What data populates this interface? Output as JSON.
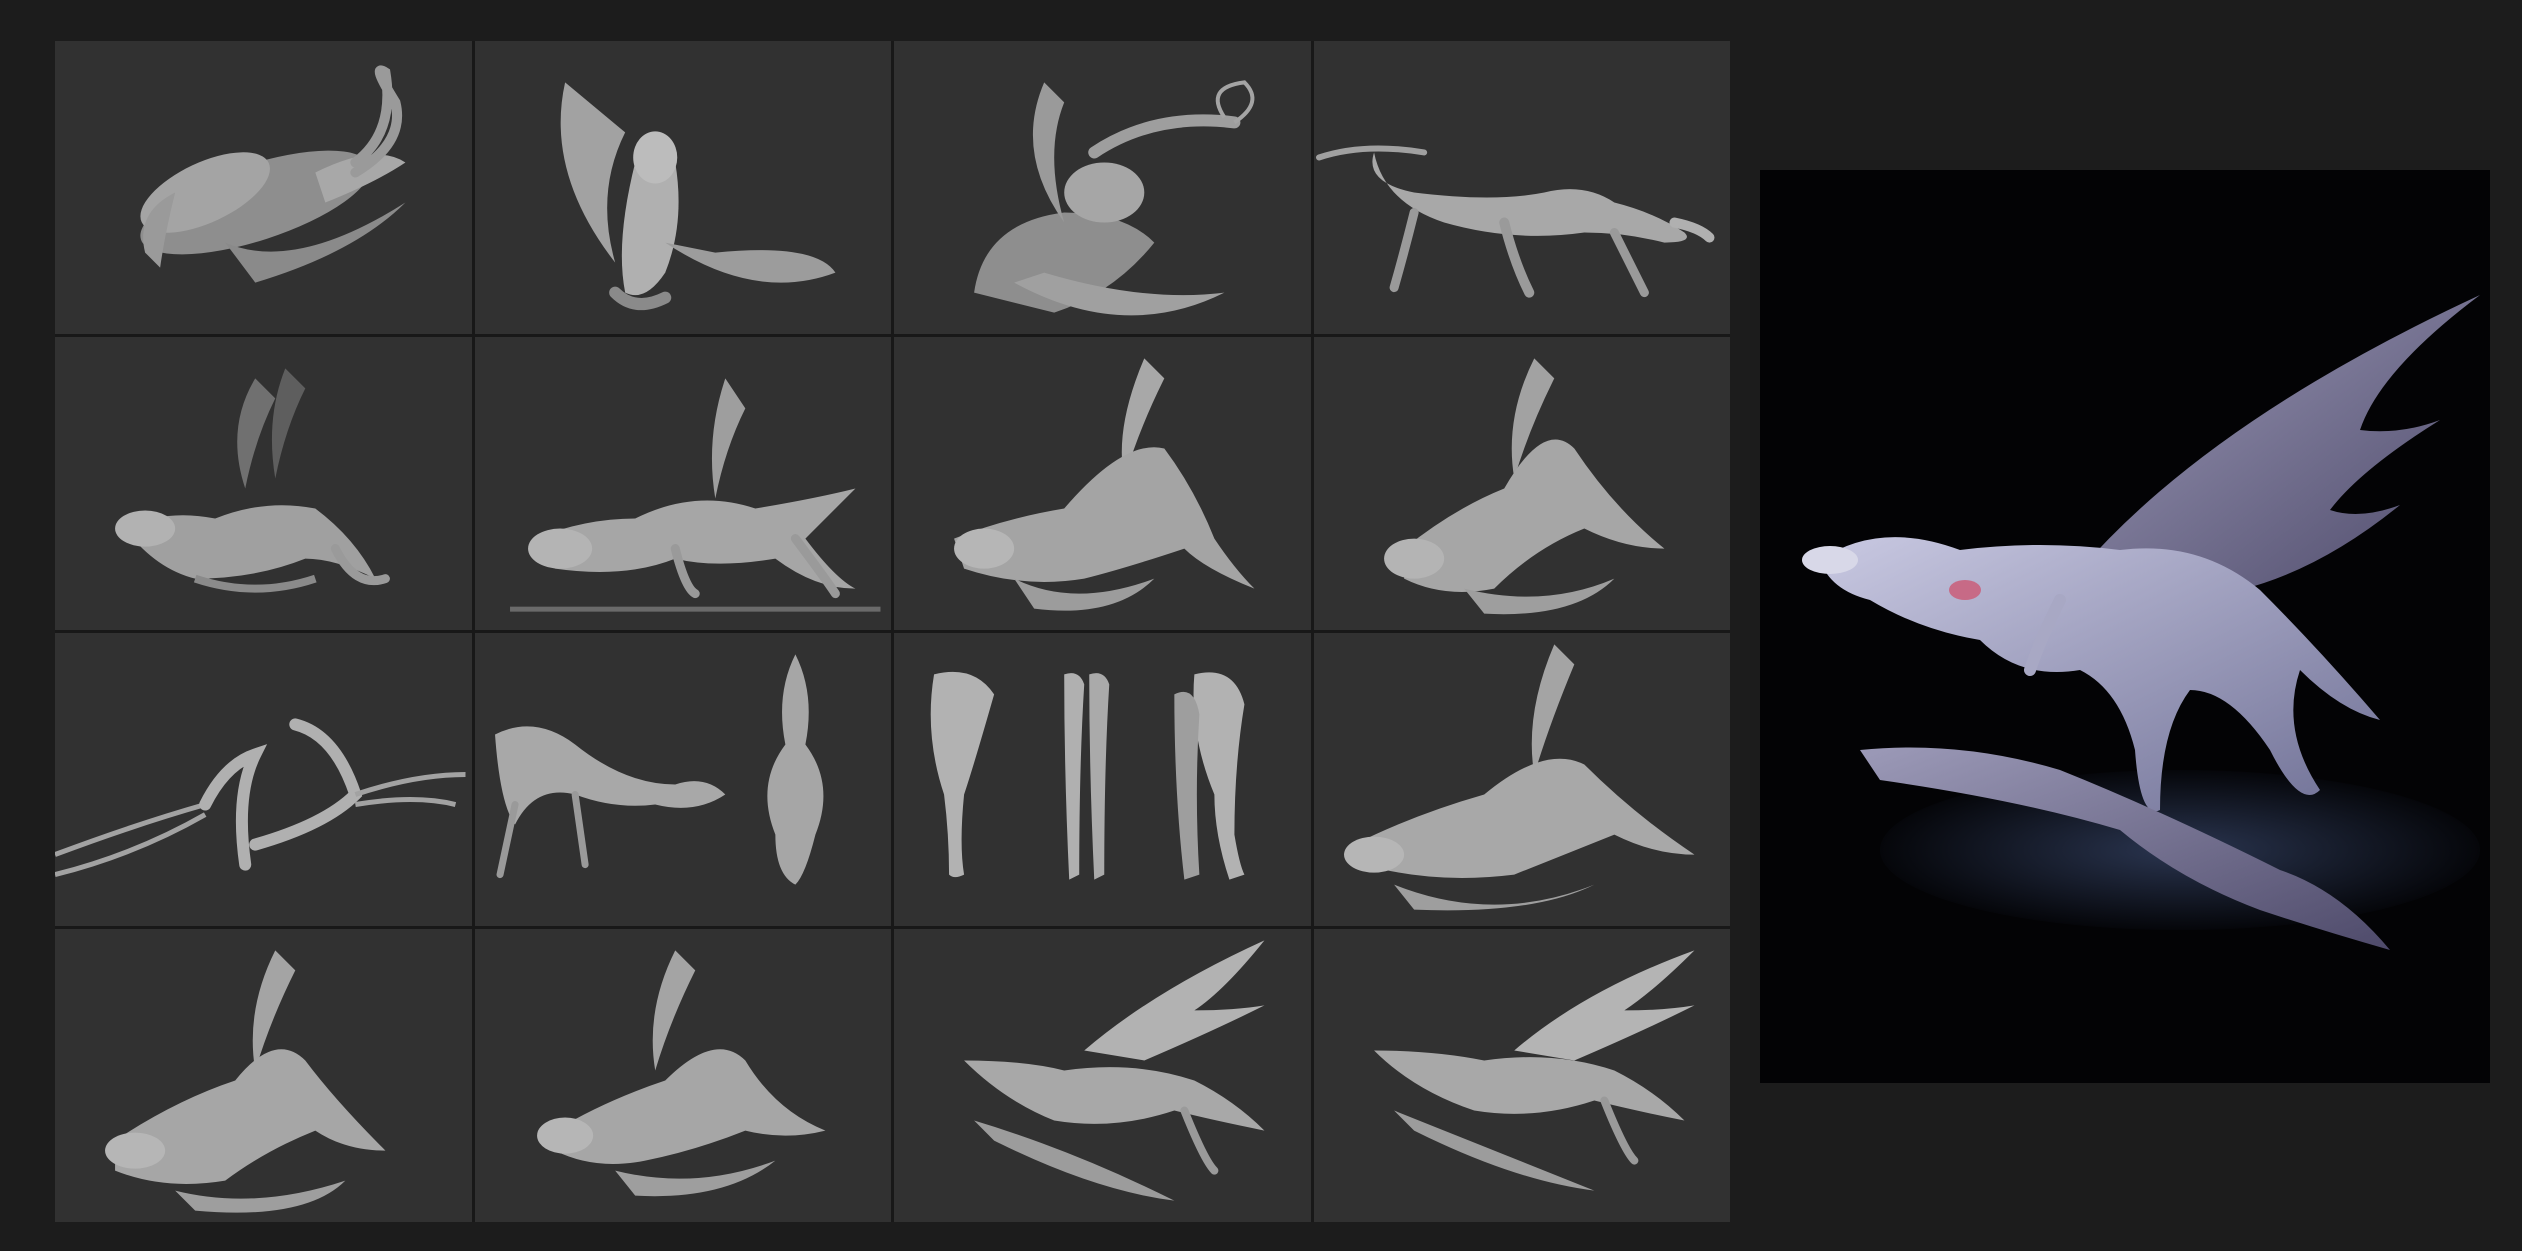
{
  "background_color": "#1c1c1c",
  "sculpt_color": "#9a9a9a",
  "tile_color": "#313131",
  "render_background": "#030305",
  "thumbnails": [
    {
      "id": "t1",
      "subject": "creature-curled-top-view"
    },
    {
      "id": "t2",
      "subject": "creature-wing-spread-top"
    },
    {
      "id": "t3",
      "subject": "creature-tail-curl-perspective"
    },
    {
      "id": "t4",
      "subject": "creature-walking-side"
    },
    {
      "id": "t5",
      "subject": "creature-crouch-wings-up"
    },
    {
      "id": "t6",
      "subject": "creature-lunge-with-base"
    },
    {
      "id": "t7",
      "subject": "creature-crouch-wings-folded"
    },
    {
      "id": "t8",
      "subject": "creature-crouch-front-angle"
    },
    {
      "id": "t9",
      "subject": "arm-wing-bone-studies"
    },
    {
      "id": "t10",
      "subject": "creature-side-and-top-view"
    },
    {
      "id": "t11",
      "subject": "hind-leg-studies"
    },
    {
      "id": "t12",
      "subject": "creature-crouch-wing-down"
    },
    {
      "id": "t13",
      "subject": "creature-crouch-low-angle"
    },
    {
      "id": "t14",
      "subject": "creature-crouch-three-quarter"
    },
    {
      "id": "t15",
      "subject": "creature-leap-wings-spread"
    },
    {
      "id": "t16",
      "subject": "creature-leap-wings-back"
    }
  ],
  "final_render": {
    "subject": "bat-creature-final-render"
  }
}
